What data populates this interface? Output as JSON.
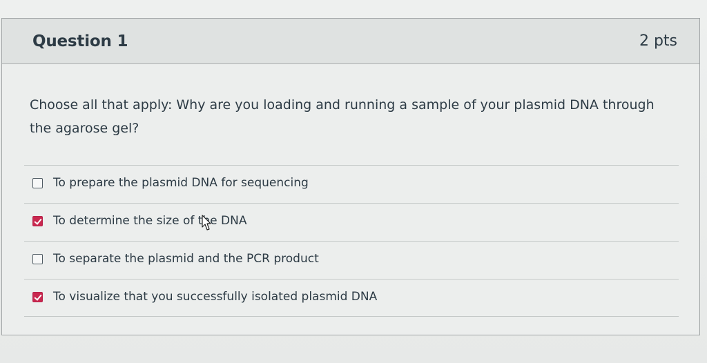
{
  "question": {
    "title": "Question 1",
    "points": "2 pts",
    "text": "Choose all that apply: Why are you  loading and running a sample of your plasmid DNA through the agarose gel?",
    "answers": [
      {
        "label": "To prepare the plasmid DNA for sequencing",
        "checked": false
      },
      {
        "label": "To determine the size of the DNA",
        "checked": true
      },
      {
        "label": "To separate the plasmid and the PCR product",
        "checked": false
      },
      {
        "label": "To visualize that you successfully isolated plasmid DNA",
        "checked": true
      }
    ]
  },
  "colors": {
    "checked_accent": "#c9284f",
    "text": "#2d3b45",
    "header_bg": "#dfe2e1"
  },
  "icons": {
    "cursor": "mouse-pointer-icon",
    "checkbox_checked": "checkmark-icon"
  }
}
